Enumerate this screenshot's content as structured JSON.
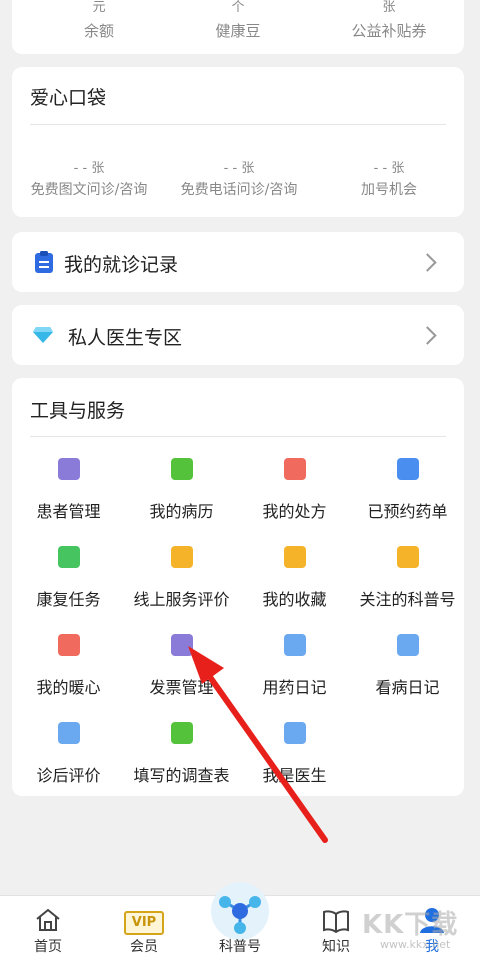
{
  "top_stats": [
    {
      "value": "元",
      "label": "余额"
    },
    {
      "value": "个",
      "label": "健康豆"
    },
    {
      "value": "张",
      "label": "公益补贴券"
    }
  ],
  "pocket": {
    "title": "爱心口袋",
    "items": [
      {
        "value": "- - 张",
        "label": "免费图文问诊/咨询"
      },
      {
        "value": "- - 张",
        "label": "免费电话问诊/咨询"
      },
      {
        "value": "- - 张",
        "label": "加号机会"
      }
    ]
  },
  "records": {
    "title": "我的就诊记录",
    "icon": "clipboard-icon"
  },
  "private_doctor": {
    "title": "私人医生专区",
    "icon": "diamond-icon"
  },
  "tools": {
    "title": "工具与服务",
    "items": [
      {
        "label": "患者管理",
        "icon": "patient-manage-icon",
        "color": "#8a7bd9"
      },
      {
        "label": "我的病历",
        "icon": "medical-record-icon",
        "color": "#55c23c"
      },
      {
        "label": "我的处方",
        "icon": "prescription-icon",
        "color": "#f06a5e"
      },
      {
        "label": "已预约药单",
        "icon": "pill-clock-icon",
        "color": "#4a8ff0"
      },
      {
        "label": "康复任务",
        "icon": "rehab-task-icon",
        "color": "#45c45f"
      },
      {
        "label": "线上服务评价",
        "icon": "service-rating-icon",
        "color": "#f5b32a"
      },
      {
        "label": "我的收藏",
        "icon": "star-icon",
        "color": "#f5b32a"
      },
      {
        "label": "关注的科普号",
        "icon": "science-account-icon",
        "color": "#f5b32a"
      },
      {
        "label": "我的暖心",
        "icon": "heart-hand-icon",
        "color": "#f06a5e"
      },
      {
        "label": "发票管理",
        "icon": "invoice-icon",
        "color": "#8a7bd9"
      },
      {
        "label": "用药日记",
        "icon": "capsule-icon",
        "color": "#6aa8f0"
      },
      {
        "label": "看病日记",
        "icon": "diary-heart-icon",
        "color": "#6aa8f0"
      },
      {
        "label": "诊后评价",
        "icon": "post-visit-review-icon",
        "color": "#6aa8f0"
      },
      {
        "label": "填写的调查表",
        "icon": "survey-icon",
        "color": "#55c23c"
      },
      {
        "label": "我是医生",
        "icon": "doctor-icon",
        "color": "#6aa8f0"
      }
    ]
  },
  "tabbar": [
    {
      "label": "首页",
      "icon": "home-icon"
    },
    {
      "label": "会员",
      "icon": "vip-icon",
      "badge": "VIP"
    },
    {
      "label": "科普号",
      "icon": "science-hub-icon"
    },
    {
      "label": "知识",
      "icon": "book-icon"
    },
    {
      "label": "我",
      "icon": "person-icon"
    }
  ],
  "watermark": {
    "text": "KK下载",
    "subtext": "www.kkx.net"
  }
}
